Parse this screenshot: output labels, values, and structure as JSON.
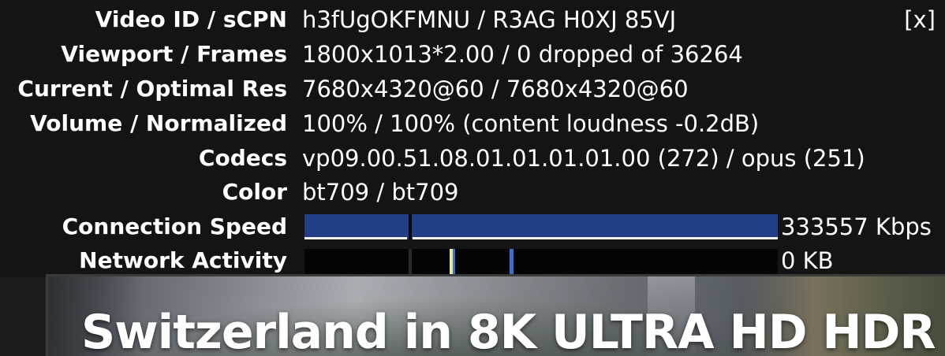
{
  "stats": {
    "close_label": "[x]",
    "rows": [
      {
        "label": "Video ID / sCPN",
        "value": "h3fUgOKFMNU / R3AG H0XJ 85VJ"
      },
      {
        "label": "Viewport / Frames",
        "value": "1800x1013*2.00 / 0 dropped of 36264"
      },
      {
        "label": "Current / Optimal Res",
        "value": "7680x4320@60 / 7680x4320@60"
      },
      {
        "label": "Volume / Normalized",
        "value": "100% / 100% (content loudness -0.2dB)"
      },
      {
        "label": "Codecs",
        "value": "vp09.00.51.08.01.01.01.01.00 (272) / opus (251)"
      },
      {
        "label": "Color",
        "value": "bt709 / bt709"
      }
    ],
    "connection_speed": {
      "label": "Connection Speed",
      "value": "333557 Kbps",
      "color": "#213f86"
    },
    "network_activity": {
      "label": "Network Activity",
      "value": "0 KB",
      "color": "#050505"
    }
  },
  "video": {
    "title": "Switzerland in 8K ULTRA HD HDR -"
  }
}
